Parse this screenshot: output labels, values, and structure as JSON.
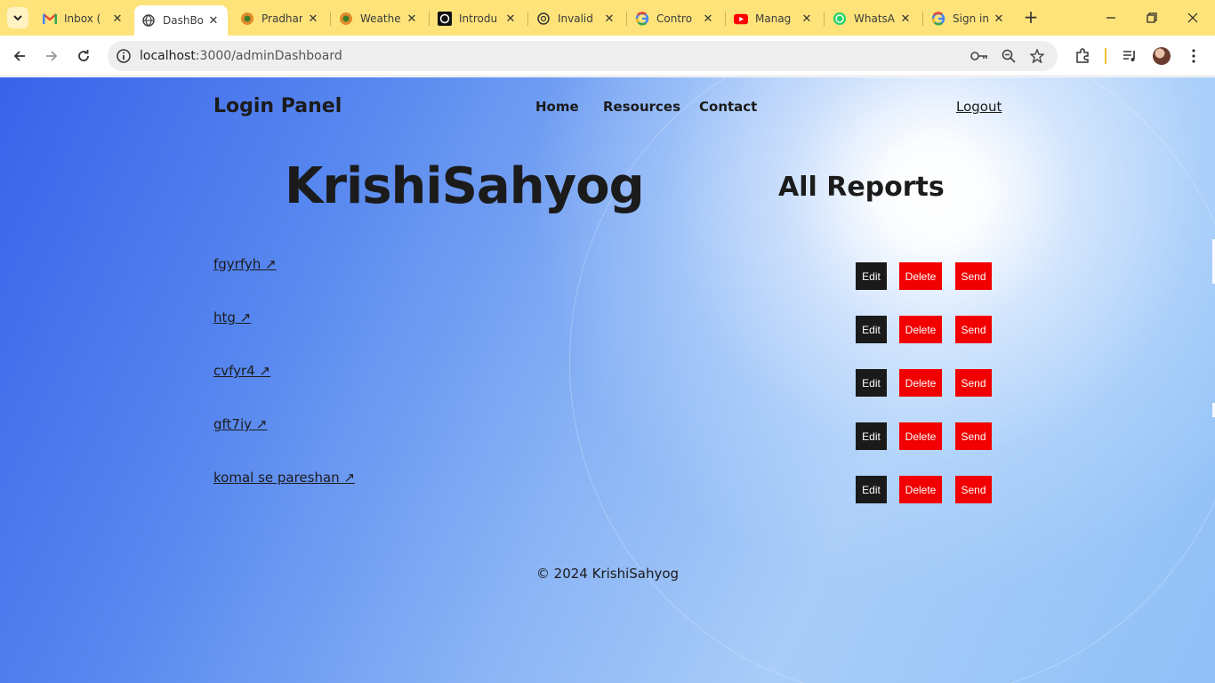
{
  "browser": {
    "tabs": [
      {
        "title": "Inbox (",
        "icon": "gmail-icon",
        "active": false
      },
      {
        "title": "DashBo",
        "icon": "globe-icon",
        "active": true
      },
      {
        "title": "Pradhan",
        "icon": "emblem-icon",
        "active": false
      },
      {
        "title": "Weathe",
        "icon": "emblem-icon",
        "active": false
      },
      {
        "title": "Introdu",
        "icon": "openai-icon",
        "active": false
      },
      {
        "title": "Invalid",
        "icon": "openai-icon",
        "active": false
      },
      {
        "title": "Contro",
        "icon": "google-icon",
        "active": false
      },
      {
        "title": "Manag",
        "icon": "youtube-icon",
        "active": false
      },
      {
        "title": "WhatsA",
        "icon": "whatsapp-icon",
        "active": false
      },
      {
        "title": "Sign in",
        "icon": "google-icon",
        "active": false
      }
    ],
    "url_host": "localhost",
    "url_path": ":3000/adminDashboard"
  },
  "page": {
    "brand": "Login Panel",
    "nav": {
      "home": "Home",
      "resources": "Resources",
      "contact": "Contact"
    },
    "logout": "Logout",
    "hero_title": "KrishiSahyog",
    "section_title": "All Reports",
    "reports": [
      {
        "name": "fgyrfyh ↗",
        "edit": "Edit",
        "delete": "Delete",
        "send": "Send"
      },
      {
        "name": "htg ↗",
        "edit": "Edit",
        "delete": "Delete",
        "send": "Send"
      },
      {
        "name": "cvfyr4 ↗",
        "edit": "Edit",
        "delete": "Delete",
        "send": "Send"
      },
      {
        "name": "gft7iy ↗",
        "edit": "Edit",
        "delete": "Delete",
        "send": "Send"
      },
      {
        "name": "komal se pareshan ↗",
        "edit": "Edit",
        "delete": "Delete",
        "send": "Send"
      }
    ],
    "footer": "© 2024 KrishiSahyog"
  },
  "colors": {
    "edit_button": "#1a1a1a",
    "danger_button": "#f20000",
    "tabstrip": "#fde37a"
  }
}
